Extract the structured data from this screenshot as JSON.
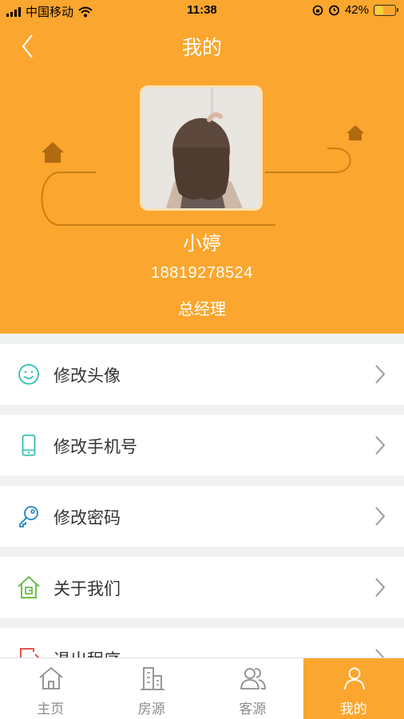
{
  "status_bar": {
    "carrier": "中国移动",
    "time": "11:38",
    "battery_percent_text": "42%",
    "battery_level": 0.42
  },
  "header": {
    "title": "我的"
  },
  "profile": {
    "name": "小婷",
    "phone": "18819278524",
    "role": "总经理"
  },
  "menu": {
    "items": [
      {
        "label": "修改头像",
        "icon": "smiley-face-icon"
      },
      {
        "label": "修改手机号",
        "icon": "mobile-phone-icon"
      },
      {
        "label": "修改密码",
        "icon": "key-icon"
      },
      {
        "label": "关于我们",
        "icon": "house-icon"
      },
      {
        "label": "退出程序",
        "icon": "logout-icon"
      }
    ]
  },
  "tabbar": {
    "tabs": [
      {
        "label": "主页",
        "icon": "home-icon"
      },
      {
        "label": "房源",
        "icon": "building-icon"
      },
      {
        "label": "客源",
        "icon": "people-icon"
      },
      {
        "label": "我的",
        "icon": "person-icon"
      }
    ],
    "active_index": 3
  },
  "colors": {
    "accent": "#fba62e",
    "icon_teal": "#2fc0b2",
    "icon_green": "#6cc04a",
    "icon_red": "#e8534a"
  }
}
